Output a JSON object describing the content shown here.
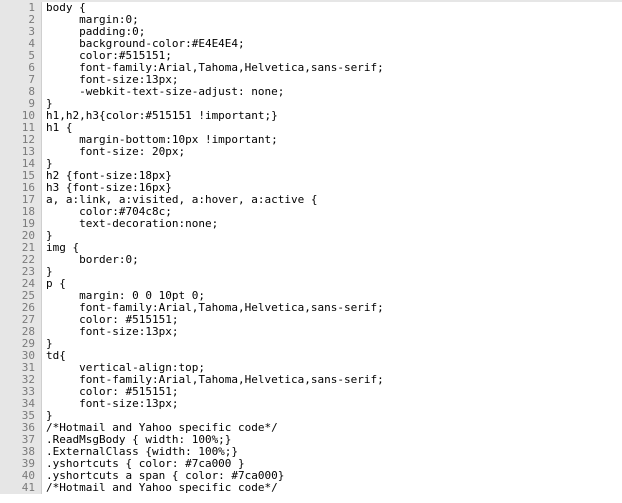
{
  "code": {
    "lines": [
      {
        "n": 1,
        "text": "body {"
      },
      {
        "n": 2,
        "text": "     margin:0;"
      },
      {
        "n": 3,
        "text": "     padding:0;"
      },
      {
        "n": 4,
        "text": "     background-color:#E4E4E4;"
      },
      {
        "n": 5,
        "text": "     color:#515151;"
      },
      {
        "n": 6,
        "text": "     font-family:Arial,Tahoma,Helvetica,sans-serif;"
      },
      {
        "n": 7,
        "text": "     font-size:13px;"
      },
      {
        "n": 8,
        "text": "     -webkit-text-size-adjust: none;"
      },
      {
        "n": 9,
        "text": "}"
      },
      {
        "n": 10,
        "text": "h1,h2,h3{color:#515151 !important;}"
      },
      {
        "n": 11,
        "text": "h1 {"
      },
      {
        "n": 12,
        "text": "     margin-bottom:10px !important;"
      },
      {
        "n": 13,
        "text": "     font-size: 20px;"
      },
      {
        "n": 14,
        "text": "}"
      },
      {
        "n": 15,
        "text": "h2 {font-size:18px}"
      },
      {
        "n": 16,
        "text": "h3 {font-size:16px}"
      },
      {
        "n": 17,
        "text": "a, a:link, a:visited, a:hover, a:active {"
      },
      {
        "n": 18,
        "text": "     color:#704c8c;"
      },
      {
        "n": 19,
        "text": "     text-decoration:none;"
      },
      {
        "n": 20,
        "text": "}"
      },
      {
        "n": 21,
        "text": "img {"
      },
      {
        "n": 22,
        "text": "     border:0;"
      },
      {
        "n": 23,
        "text": "}"
      },
      {
        "n": 24,
        "text": "p {"
      },
      {
        "n": 25,
        "text": "     margin: 0 0 10pt 0;"
      },
      {
        "n": 26,
        "text": "     font-family:Arial,Tahoma,Helvetica,sans-serif;"
      },
      {
        "n": 27,
        "text": "     color: #515151;"
      },
      {
        "n": 28,
        "text": "     font-size:13px;"
      },
      {
        "n": 29,
        "text": "}"
      },
      {
        "n": 30,
        "text": "td{"
      },
      {
        "n": 31,
        "text": "     vertical-align:top;"
      },
      {
        "n": 32,
        "text": "     font-family:Arial,Tahoma,Helvetica,sans-serif;"
      },
      {
        "n": 33,
        "text": "     color: #515151;"
      },
      {
        "n": 34,
        "text": "     font-size:13px;"
      },
      {
        "n": 35,
        "text": "}"
      },
      {
        "n": 36,
        "text": "/*Hotmail and Yahoo specific code*/"
      },
      {
        "n": 37,
        "text": ".ReadMsgBody { width: 100%;}"
      },
      {
        "n": 38,
        "text": ".ExternalClass {width: 100%;}"
      },
      {
        "n": 39,
        "text": ".yshortcuts { color: #7ca000 }"
      },
      {
        "n": 40,
        "text": ".yshortcuts a span { color: #7ca000}"
      },
      {
        "n": 41,
        "text": "/*Hotmail and Yahoo specific code*/"
      }
    ]
  }
}
